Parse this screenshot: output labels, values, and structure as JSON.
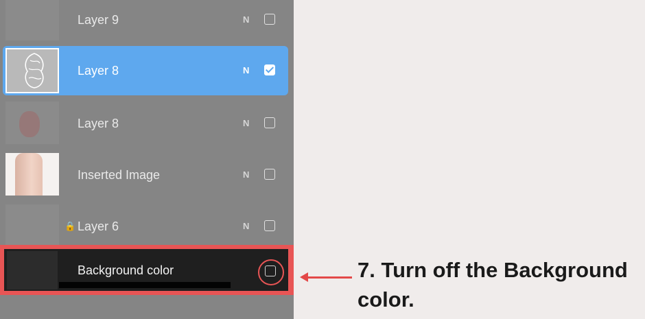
{
  "layers": [
    {
      "name": "Layer 9",
      "mode": "N",
      "checked": false
    },
    {
      "name": "Layer 8",
      "mode": "N",
      "checked": true,
      "selected": true
    },
    {
      "name": "Layer 8",
      "mode": "N",
      "checked": false
    },
    {
      "name": "Inserted Image",
      "mode": "N",
      "checked": false
    },
    {
      "name": "Layer 6",
      "mode": "N",
      "checked": false,
      "locked": true
    },
    {
      "name": "Background color",
      "checked": false
    }
  ],
  "icons": {
    "lock": "lock-icon",
    "checkbox": "checkbox-icon",
    "arrow": "arrow-left-icon"
  },
  "colors": {
    "selected": "#5ea8ee",
    "highlight": "#e85555",
    "panel": "#858585"
  },
  "instruction": "7. Turn off the Background color."
}
